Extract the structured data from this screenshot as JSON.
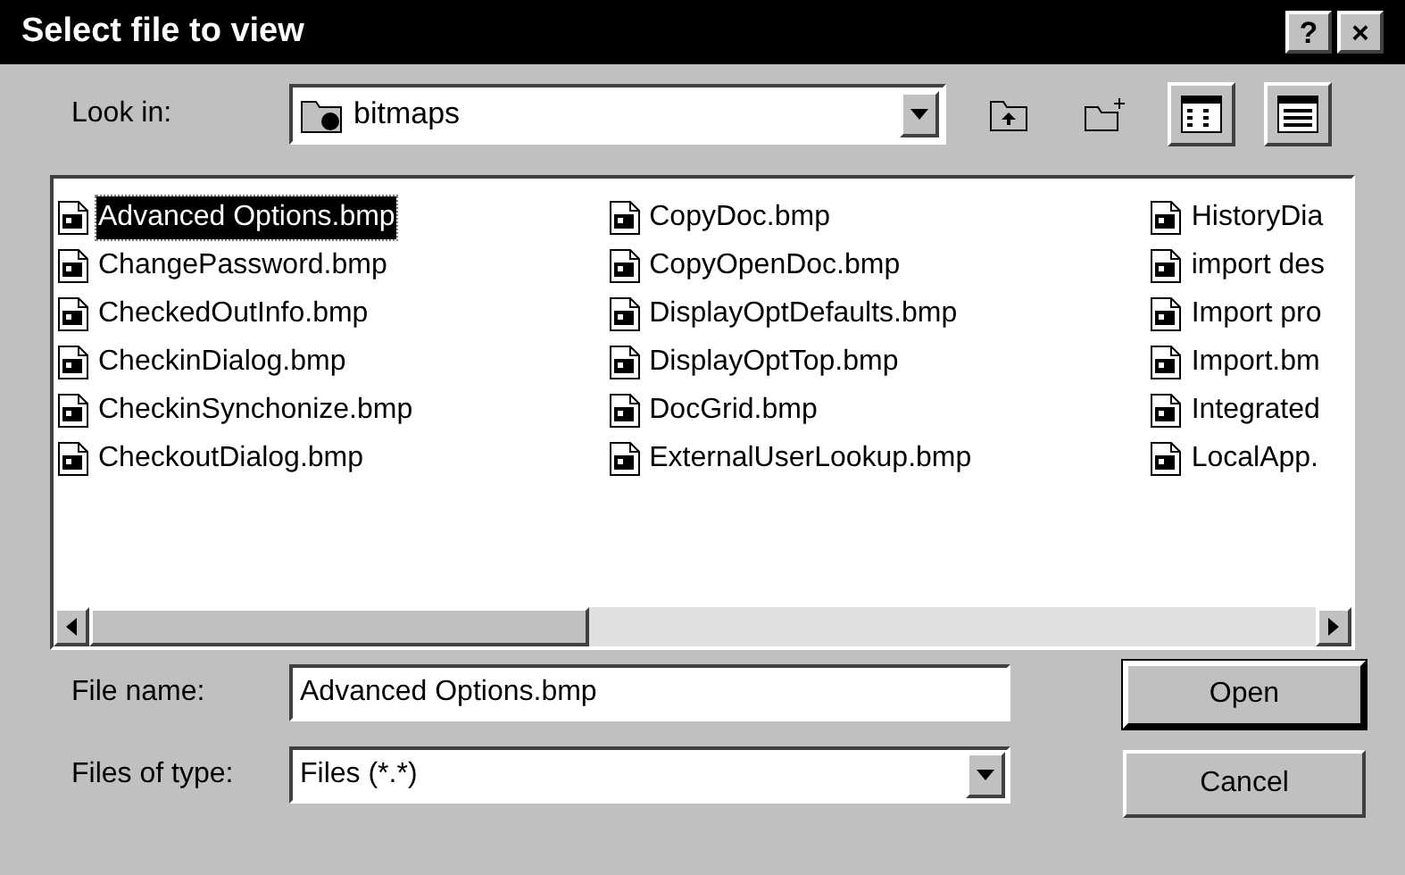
{
  "window": {
    "title": "Select file to view"
  },
  "title_buttons": [
    "?",
    "×"
  ],
  "look_in": {
    "label": "Look in:",
    "value": "bitmaps"
  },
  "files": [
    [
      {
        "name": "Advanced Options.bmp",
        "selected": true
      },
      {
        "name": "ChangePassword.bmp",
        "selected": false
      },
      {
        "name": "CheckedOutInfo.bmp",
        "selected": false
      },
      {
        "name": "CheckinDialog.bmp",
        "selected": false
      },
      {
        "name": "CheckinSynchonize.bmp",
        "selected": false
      },
      {
        "name": "CheckoutDialog.bmp",
        "selected": false
      }
    ],
    [
      {
        "name": "CopyDoc.bmp",
        "selected": false
      },
      {
        "name": "CopyOpenDoc.bmp",
        "selected": false
      },
      {
        "name": "DisplayOptDefaults.bmp",
        "selected": false
      },
      {
        "name": "DisplayOptTop.bmp",
        "selected": false
      },
      {
        "name": "DocGrid.bmp",
        "selected": false
      },
      {
        "name": "ExternalUserLookup.bmp",
        "selected": false
      }
    ],
    [
      {
        "name": "HistoryDia",
        "selected": false
      },
      {
        "name": "import des",
        "selected": false
      },
      {
        "name": "Import pro",
        "selected": false
      },
      {
        "name": "Import.bm",
        "selected": false
      },
      {
        "name": "Integrated",
        "selected": false
      },
      {
        "name": "LocalApp.",
        "selected": false
      }
    ]
  ],
  "file_name": {
    "label": "File name:",
    "value": "Advanced Options.bmp"
  },
  "files_of_type": {
    "label": "Files of type:",
    "value": "Files (*.*)"
  },
  "buttons": [
    "Open",
    "Cancel"
  ]
}
